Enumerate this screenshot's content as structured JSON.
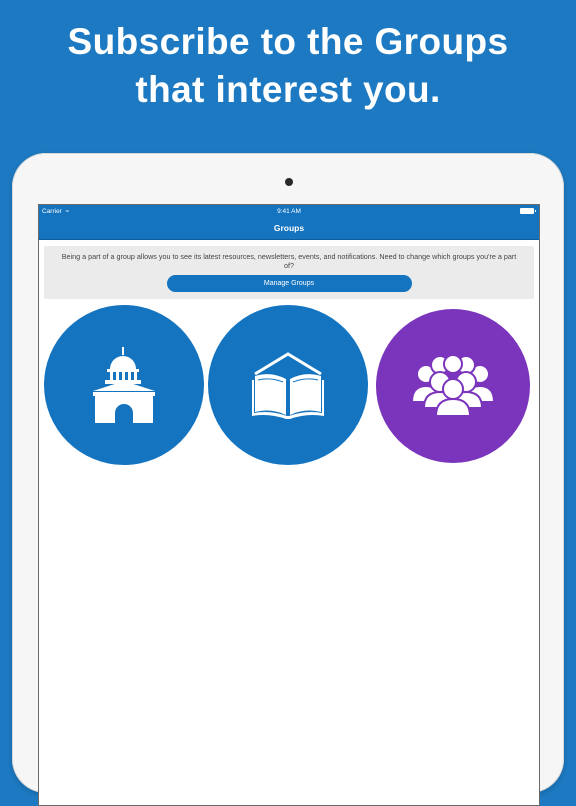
{
  "headline": {
    "line1": "Subscribe to the Groups",
    "line2": "that interest you."
  },
  "status_bar": {
    "carrier": "Carrier",
    "time": "9:41 AM"
  },
  "nav": {
    "title": "Groups"
  },
  "info": {
    "text": "Being a part of a group allows you to see its latest resources, newsletters, events, and notifications. Need to change which groups you're a part of?",
    "button_label": "Manage Groups"
  },
  "groups": [
    {
      "icon": "capitol-building-icon",
      "color": "#1474c0"
    },
    {
      "icon": "open-book-icon",
      "color": "#1474c0"
    },
    {
      "icon": "people-group-icon",
      "color": "#7b35bd"
    }
  ],
  "colors": {
    "background": "#1d7ac2",
    "accent": "#1474c0",
    "purple": "#7b35bd"
  }
}
